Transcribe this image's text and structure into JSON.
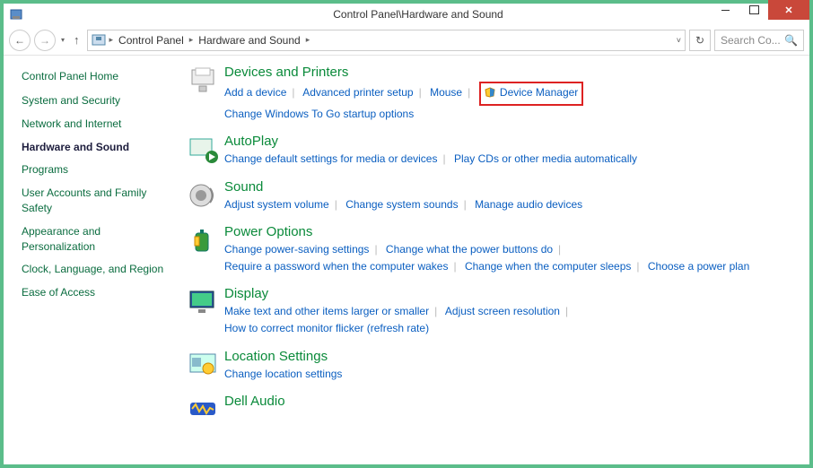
{
  "window": {
    "title": "Control Panel\\Hardware and Sound"
  },
  "breadcrumbs": {
    "a": "Control Panel",
    "b": "Hardware and Sound"
  },
  "search": {
    "placeholder": "Search Co..."
  },
  "sidebar": {
    "home": "Control Panel Home",
    "items": [
      "System and Security",
      "Network and Internet",
      "Hardware and Sound",
      "Programs",
      "User Accounts and Family Safety",
      "Appearance and Personalization",
      "Clock, Language, and Region",
      "Ease of Access"
    ]
  },
  "cats": {
    "dev": {
      "title": "Devices and Printers",
      "l0": "Add a device",
      "l1": "Advanced printer setup",
      "l2": "Mouse",
      "l3": "Device Manager",
      "l4": "Change Windows To Go startup options"
    },
    "auto": {
      "title": "AutoPlay",
      "l0": "Change default settings for media or devices",
      "l1": "Play CDs or other media automatically"
    },
    "sound": {
      "title": "Sound",
      "l0": "Adjust system volume",
      "l1": "Change system sounds",
      "l2": "Manage audio devices"
    },
    "power": {
      "title": "Power Options",
      "l0": "Change power-saving settings",
      "l1": "Change what the power buttons do",
      "l2": "Require a password when the computer wakes",
      "l3": "Change when the computer sleeps",
      "l4": "Choose a power plan"
    },
    "display": {
      "title": "Display",
      "l0": "Make text and other items larger or smaller",
      "l1": "Adjust screen resolution",
      "l2": "How to correct monitor flicker (refresh rate)"
    },
    "loc": {
      "title": "Location Settings",
      "l0": "Change location settings"
    },
    "dell": {
      "title": "Dell Audio"
    }
  }
}
